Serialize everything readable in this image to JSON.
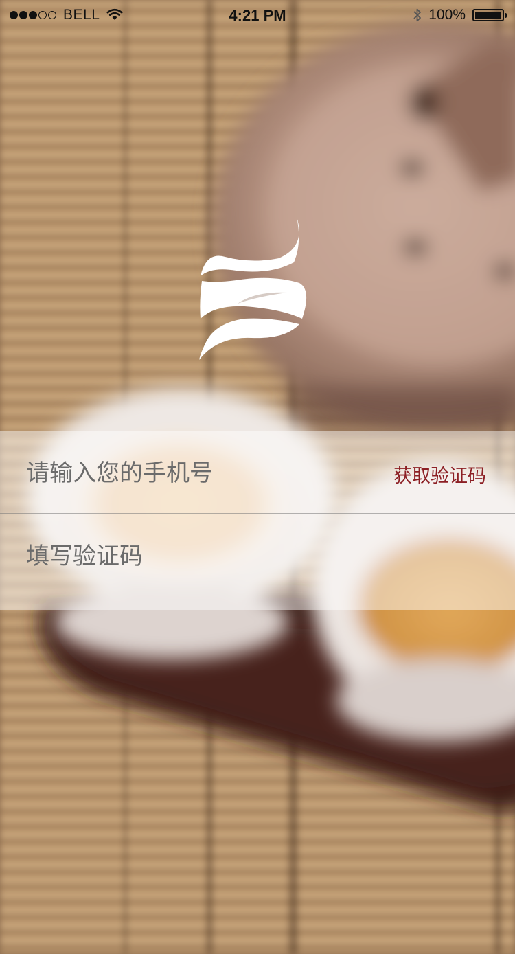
{
  "status_bar": {
    "carrier": "BELL",
    "time": "4:21 PM",
    "battery": "100%",
    "signal_bars_filled": 3,
    "signal_bars_total": 5,
    "icons": [
      "wifi-icon",
      "bluetooth-icon",
      "battery-icon"
    ]
  },
  "logo": {
    "icon": "tea-leaf-logo-icon",
    "color": "#ffffff"
  },
  "login_form": {
    "phone_placeholder": "请输入您的手机号",
    "phone_value": "",
    "get_code_label": "获取验证码",
    "code_placeholder": "填写验证码",
    "code_value": "",
    "accent_color": "#8c1f24"
  }
}
